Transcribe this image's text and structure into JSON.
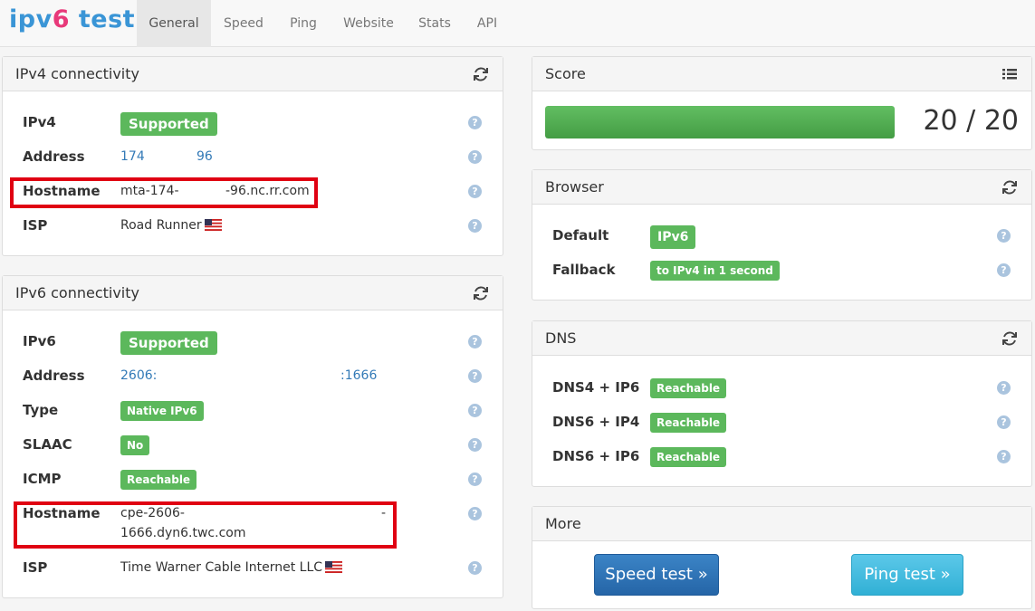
{
  "brand": {
    "part1": "ipv",
    "part2": "6",
    "part3": " test"
  },
  "nav": [
    {
      "label": "General",
      "active": true
    },
    {
      "label": "Speed"
    },
    {
      "label": "Ping"
    },
    {
      "label": "Website"
    },
    {
      "label": "Stats"
    },
    {
      "label": "API"
    }
  ],
  "ipv4": {
    "title": "IPv4 connectivity",
    "rows": {
      "ipv4": {
        "label": "IPv4",
        "value": "Supported"
      },
      "address": {
        "label": "Address",
        "part1": "174",
        "part2": "96"
      },
      "hostname": {
        "label": "Hostname",
        "part1": "mta-174-",
        "part2": "-96.nc.rr.com"
      },
      "isp": {
        "label": "ISP",
        "value": "Road Runner"
      }
    }
  },
  "ipv6": {
    "title": "IPv6 connectivity",
    "rows": {
      "ipv6": {
        "label": "IPv6",
        "value": "Supported"
      },
      "address": {
        "label": "Address",
        "part1": "2606:",
        "part2": ":1666"
      },
      "type": {
        "label": "Type",
        "value": "Native IPv6"
      },
      "slaac": {
        "label": "SLAAC",
        "value": "No"
      },
      "icmp": {
        "label": "ICMP",
        "value": "Reachable"
      },
      "hostname": {
        "label": "Hostname",
        "line1": "cpe-2606-",
        "line1_end": "-",
        "line2": "1666.dyn6.twc.com"
      },
      "isp": {
        "label": "ISP",
        "value": "Time Warner Cable Internet LLC"
      }
    }
  },
  "score": {
    "title": "Score",
    "value": "20 / 20",
    "progress": 1.0
  },
  "browser": {
    "title": "Browser",
    "default": {
      "label": "Default",
      "value": "IPv6"
    },
    "fallback": {
      "label": "Fallback",
      "value": "to IPv4 in 1 second"
    }
  },
  "dns": {
    "title": "DNS",
    "rows": [
      {
        "label": "DNS4 + IP6",
        "value": "Reachable"
      },
      {
        "label": "DNS6 + IP4",
        "value": "Reachable"
      },
      {
        "label": "DNS6 + IP6",
        "value": "Reachable"
      }
    ]
  },
  "more": {
    "title": "More",
    "speed_btn": "Speed test »",
    "ping_btn": "Ping test »"
  },
  "help_glyph": "?",
  "colors": {
    "success": "#5cb85c",
    "primary": "#337ab7",
    "highlight": "#e00012"
  }
}
